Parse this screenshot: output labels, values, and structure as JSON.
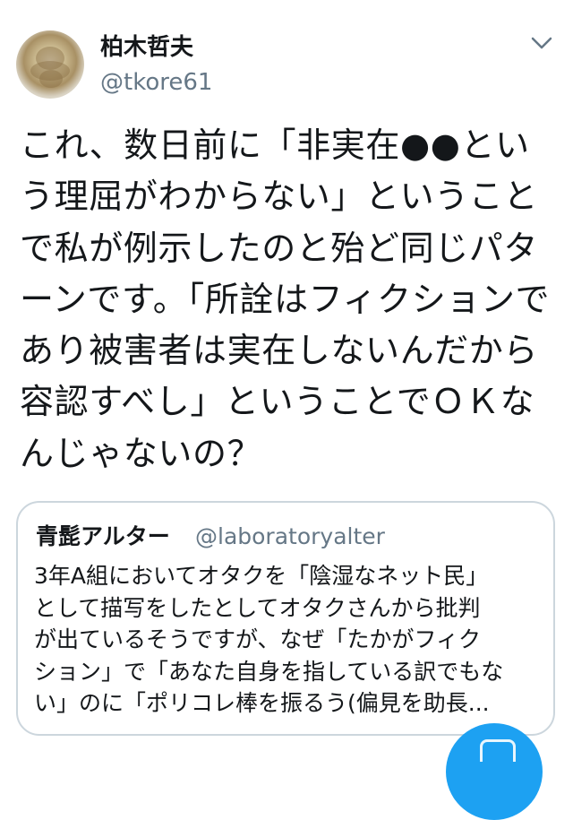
{
  "tweet": {
    "display_name": "柏木哲夫",
    "handle": "@tkore61",
    "text": "これ、数日前に「非実在●●という理屈がわからない」ということで私が例示したのと殆ど同じパターンです。「所詮はフィクションであり被害者は実在しないんだから容認すべし」ということでＯＫなんじゃないの？"
  },
  "quoted_tweet": {
    "display_name": "青髭アルター",
    "handle": "@laboratoryalter",
    "text": "3年A組においてオタクを「陰湿なネット民」\nとして描写をしたとしてオタクさんから批判\nが出ているそうですが、なぜ「たかがフィク\nション」で「あなた自身を指している訳でもな\nい」のに「ポリコレ棒を振るう(偏見を助長..."
  },
  "icons": {
    "menu": "chevron-down-icon",
    "compose": "compose-tweet-icon"
  },
  "colors": {
    "accent": "#1da1f2",
    "secondary_text": "#657786",
    "border": "#ccd6dd"
  }
}
